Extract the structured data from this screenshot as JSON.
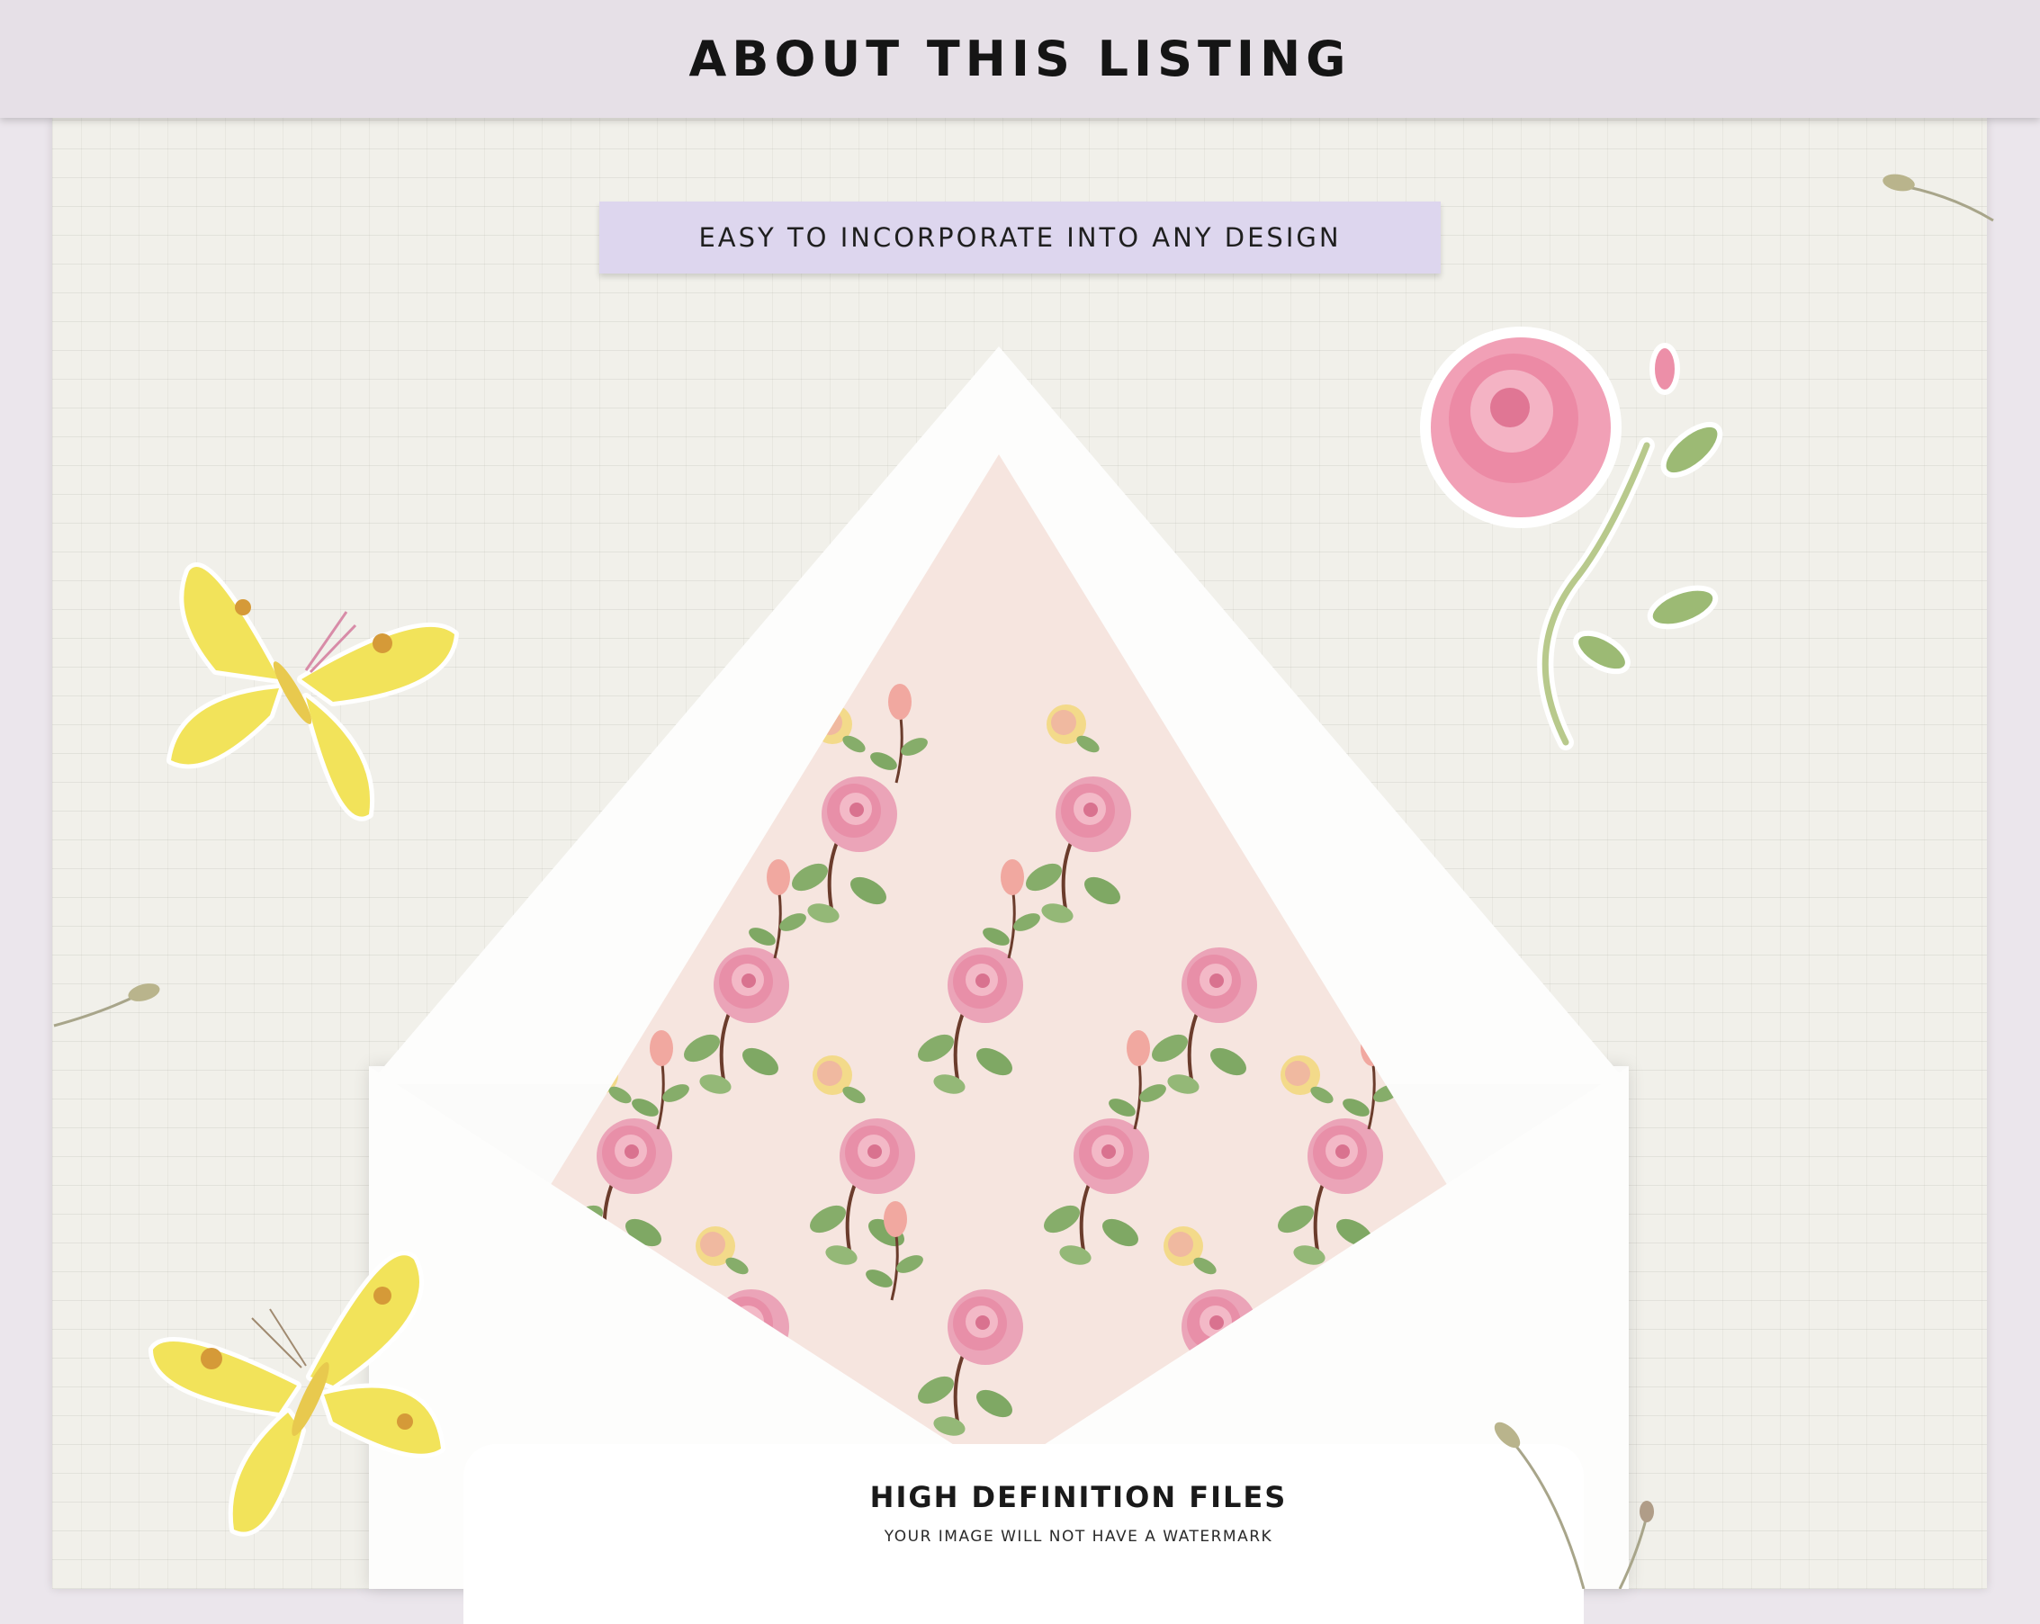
{
  "header": {
    "title": "ABOUT THIS LISTING"
  },
  "tape": {
    "label": "EASY TO INCORPORATE INTO ANY DESIGN"
  },
  "card": {
    "title": "HIGH DEFINITION FILES",
    "subtitle": "YOUR IMAGE WILL NOT HAVE A WATERMARK"
  },
  "colors": {
    "header_bg": "#e6e0e7",
    "tape_bg": "#ddd6ee",
    "paper_bg": "#f1f0ea",
    "liner_bg": "#f6e5df",
    "rose_pink": "#e98aa6",
    "butterfly_yellow": "#f2e35a",
    "leaf_green": "#7fa864"
  },
  "decorations": [
    "yellow-butterfly",
    "yellow-butterfly",
    "pink-rose-sticker",
    "dried-seed-pod",
    "rose-pattern"
  ]
}
